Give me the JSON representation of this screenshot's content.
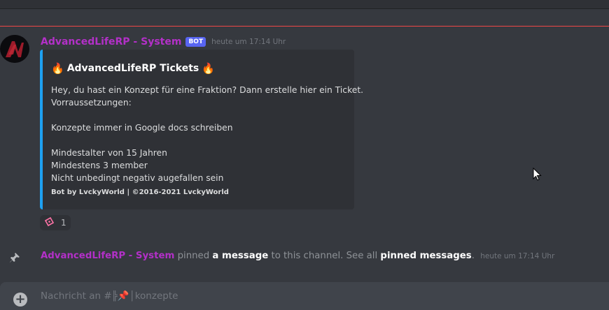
{
  "colors": {
    "background": "#36393f",
    "username": "#b330c8",
    "embed_accent": "#1ea1f2",
    "bot_badge": "#5865f2",
    "new_message_divider": "#f04747"
  },
  "message": {
    "author": "AdvancedLifeRP - System",
    "bot_tag": "BOT",
    "timestamp": "heute um 17:14 Uhr",
    "avatar_icon": "server-logo-avatar"
  },
  "embed": {
    "title_icon": "fire-icon",
    "title": "AdvancedLifeRP Tickets",
    "description_lines": [
      "Hey, du hast ein Konzept für eine Fraktion? Dann erstelle hier ein Ticket.",
      "Vorraussetzungen:",
      "",
      "Konzepte immer in Google docs schreiben",
      "",
      "Mindestalter von 15 Jahren",
      "Mindestens 3 member",
      "Nicht unbedingt negativ augefallen sein"
    ],
    "footer": "Bot by LvckyWorld | ©2016-2021 LvckyWorld"
  },
  "reaction": {
    "icon": "ticket-icon",
    "count": "1"
  },
  "system_message": {
    "icon": "pin-icon",
    "user": "AdvancedLifeRP - System",
    "text_pinned": "pinned",
    "link_message": "a message",
    "text_middle": "to this channel. See all",
    "link_pinned": "pinned messages",
    "text_end": ".",
    "timestamp": "heute um 17:14 Uhr"
  },
  "chat_input": {
    "add_icon": "plus-circle-icon",
    "placeholder": "Nachricht an #╠📌│konzepte"
  }
}
